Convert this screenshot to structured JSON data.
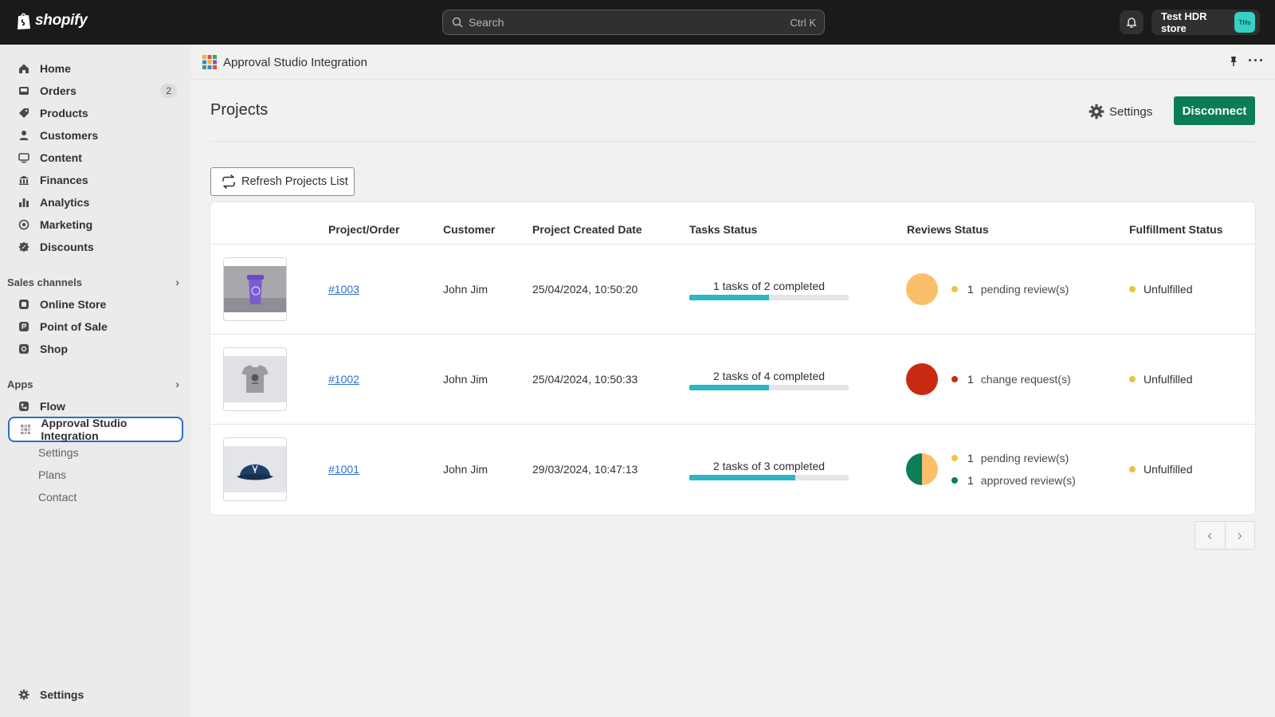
{
  "topbar": {
    "logo_text": "shopify",
    "search_placeholder": "Search",
    "search_shortcut": "Ctrl K",
    "store_name": "Test HDR store",
    "store_avatar": "THs"
  },
  "sidebar": {
    "items": [
      {
        "label": "Home",
        "icon": "home-icon"
      },
      {
        "label": "Orders",
        "icon": "inbox-icon",
        "badge": "2"
      },
      {
        "label": "Products",
        "icon": "tag-icon"
      },
      {
        "label": "Customers",
        "icon": "person-icon"
      },
      {
        "label": "Content",
        "icon": "content-icon"
      },
      {
        "label": "Finances",
        "icon": "bank-icon"
      },
      {
        "label": "Analytics",
        "icon": "bar-chart-icon"
      },
      {
        "label": "Marketing",
        "icon": "target-icon"
      },
      {
        "label": "Discounts",
        "icon": "discount-icon"
      }
    ],
    "sales_channels_label": "Sales channels",
    "sales_channels": [
      {
        "label": "Online Store",
        "icon": "store-icon"
      },
      {
        "label": "Point of Sale",
        "icon": "pos-icon"
      },
      {
        "label": "Shop",
        "icon": "shop-icon"
      }
    ],
    "apps_label": "Apps",
    "apps": [
      {
        "label": "Flow",
        "icon": "flow-icon"
      },
      {
        "label": "Approval Studio Integration",
        "icon": "app-grid-icon"
      }
    ],
    "app_subitems": [
      "Settings",
      "Plans",
      "Contact"
    ],
    "settings_label": "Settings"
  },
  "app_header": {
    "title": "Approval Studio Integration"
  },
  "page": {
    "title": "Projects",
    "settings_label": "Settings",
    "disconnect_label": "Disconnect",
    "refresh_label": "Refresh Projects List"
  },
  "table": {
    "headers": [
      "Project/Order",
      "Customer",
      "Project Created Date",
      "Tasks Status",
      "Reviews Status",
      "Fulfillment Status"
    ],
    "rows": [
      {
        "product": "purple-cup",
        "order": "#1003",
        "customer": "John Jim",
        "date": "25/04/2024, 10:50:20",
        "tasks_label": "1 tasks of 2 completed",
        "tasks_progress": 0.5,
        "reviews": [
          {
            "count": "1",
            "text": "pending review(s)",
            "color": "#f0c244"
          }
        ],
        "fulfillment": "Unfulfilled"
      },
      {
        "product": "grey-tshirt",
        "order": "#1002",
        "customer": "John Jim",
        "date": "25/04/2024, 10:50:33",
        "tasks_label": "2 tasks of 4 completed",
        "tasks_progress": 0.5,
        "reviews": [
          {
            "count": "1",
            "text": "change request(s)",
            "color": "#c72a10"
          }
        ],
        "fulfillment": "Unfulfilled"
      },
      {
        "product": "navy-cap",
        "order": "#1001",
        "customer": "John Jim",
        "date": "29/03/2024, 10:47:13",
        "tasks_label": "2 tasks of 3 completed",
        "tasks_progress": 0.667,
        "reviews": [
          {
            "count": "1",
            "text": "pending review(s)",
            "color": "#f0c244"
          },
          {
            "count": "1",
            "text": "approved review(s)",
            "color": "#0d7d57"
          }
        ],
        "fulfillment": "Unfulfilled"
      }
    ]
  },
  "colors": {
    "accent": "#0a7d57",
    "progress": "#2cb5c3",
    "pending": "#fbbf6b",
    "change": "#c72a10",
    "approved": "#0d7d57"
  }
}
